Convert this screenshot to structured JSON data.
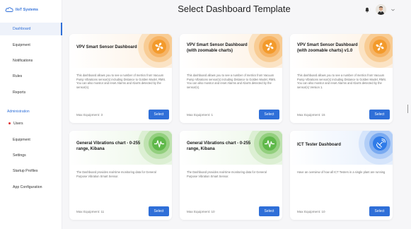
{
  "brand": {
    "name": "IIoT Systems"
  },
  "header": {
    "title": "Select Dashboard Template"
  },
  "sidebar": {
    "items": [
      {
        "label": "Dashboard",
        "active": true
      },
      {
        "label": "Equipment"
      },
      {
        "label": "Notifications"
      },
      {
        "label": "Rules"
      },
      {
        "label": "Reports"
      }
    ],
    "admin_label": "Administration",
    "admin_items": [
      {
        "label": "Users"
      },
      {
        "label": "Equipment"
      },
      {
        "label": "Settings"
      },
      {
        "label": "Startup Profiles"
      },
      {
        "label": "App Configuration"
      }
    ]
  },
  "cards": [
    {
      "title": "VPV Smart Sensor Dashboard",
      "description": "This dashboard allows you to see a number of metrics from Vacuum Pump Vibrations sensor(s) including Distance to Golden Model, RMS. You can also monitor and reset Alarms and Aborts detected by the sensor(s).",
      "max": "Max Equipment: 3",
      "button": "Select",
      "icon": "fan-icon",
      "accent": "#f39a2b"
    },
    {
      "title": "VPV Smart Sensor Dashboard (with zoomable charts)",
      "description": "This dashboard allows you to see a number of metrics from Vacuum Pump Vibrations sensor(s) including Distance to Golden Model, RMS. You can also monitor and reset Alarms and Aborts detected by the sensor(s).",
      "max": "Max Equipment: 1",
      "button": "Select",
      "icon": "fan-icon",
      "accent": "#f39a2b"
    },
    {
      "title": "VPV Smart Sensor Dashboard (with zoomable charts) v1.0",
      "description": "This dashboard allows you to see a number of metrics from Vacuum Pump Vibrations sensor(s) including Distance to Golden Model, RMS. You can also monitor and reset Alarms and Aborts detected by the sensor(s) Version 1.",
      "max": "Max Equipment: 15",
      "button": "Select",
      "icon": "fan-icon",
      "accent": "#f39a2b"
    },
    {
      "title": "General Vibrations chart - 0-255 range, Kibana",
      "description": "The Dashboard provides real-time monitoring data for General Purpose Vibration Smart Sensor.",
      "max": "Max Equipment: 11",
      "button": "Select",
      "icon": "pulse-icon",
      "accent": "#5fb84a"
    },
    {
      "title": "General Vibrations chart - 0-255 range, Kibana",
      "description": "The Dashboard provides real-time monitoring data for General Purpose Vibration Smart Sensor.",
      "max": "Max Equipment: 10",
      "button": "Select",
      "icon": "pulse-icon",
      "accent": "#5fb84a"
    },
    {
      "title": "ICT Tester Dashboard",
      "description": "Have an overview of how all ICT Testers in a single plant are running",
      "max": "Max Equipment: 10",
      "button": "Select",
      "icon": "satellite-icon",
      "accent": "#2f7be8"
    }
  ]
}
